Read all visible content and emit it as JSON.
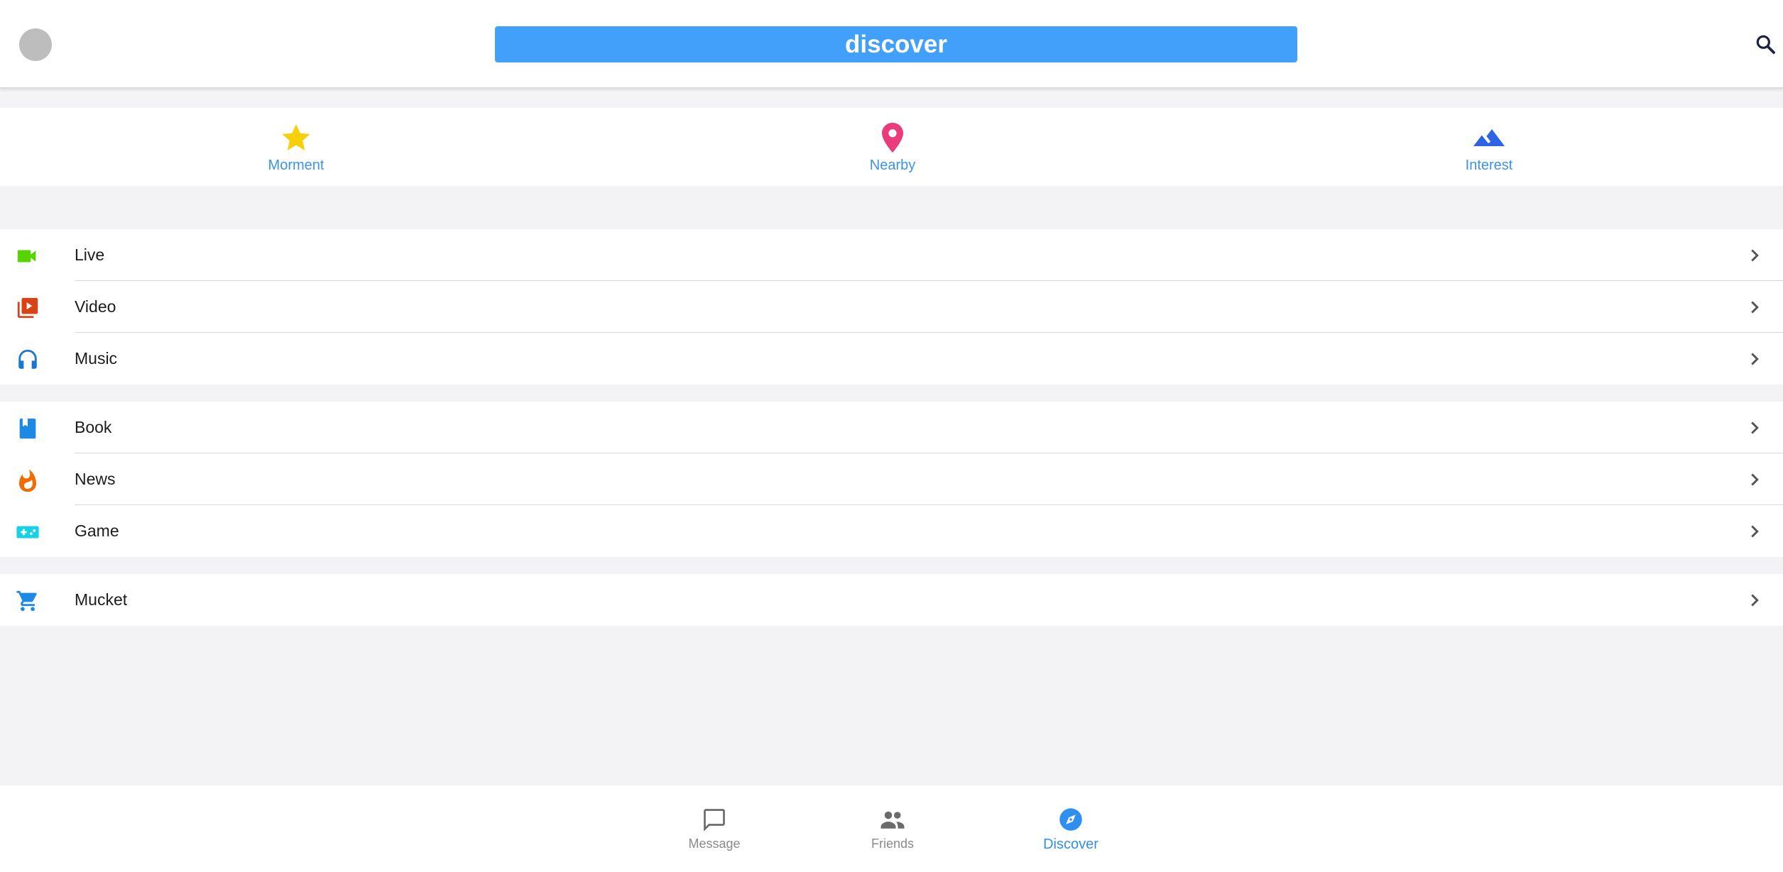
{
  "header": {
    "title": "discover",
    "avatar_icon": "avatar",
    "search_icon": "search-icon"
  },
  "quick": [
    {
      "label": "Morment",
      "icon": "star-icon",
      "color": "#f6d10b"
    },
    {
      "label": "Nearby",
      "icon": "location-pin-icon",
      "color": "#ea3c7d"
    },
    {
      "label": "Interest",
      "icon": "mountain-icon",
      "color": "#2f63e6"
    }
  ],
  "groups": [
    [
      {
        "label": "Live",
        "icon": "videocam-icon",
        "color": "#55d400"
      },
      {
        "label": "Video",
        "icon": "video-library-icon",
        "color": "#d84315"
      },
      {
        "label": "Music",
        "icon": "headphones-icon",
        "color": "#1976d2"
      }
    ],
    [
      {
        "label": "Book",
        "icon": "book-icon",
        "color": "#1e88e5"
      },
      {
        "label": "News",
        "icon": "fire-icon",
        "color": "#ef6c00"
      },
      {
        "label": "Game",
        "icon": "gamepad-icon",
        "color": "#17d1e8"
      }
    ],
    [
      {
        "label": "Mucket",
        "icon": "cart-icon",
        "color": "#1e88e5"
      }
    ]
  ],
  "bottom_nav": [
    {
      "label": "Message",
      "icon": "chat-icon",
      "active": false
    },
    {
      "label": "Friends",
      "icon": "people-icon",
      "active": false
    },
    {
      "label": "Discover",
      "icon": "compass-icon",
      "active": true
    }
  ],
  "colors": {
    "accent": "#42a0fb",
    "active_nav": "#2f8ff0",
    "inactive_nav": "#6b6b6b"
  }
}
